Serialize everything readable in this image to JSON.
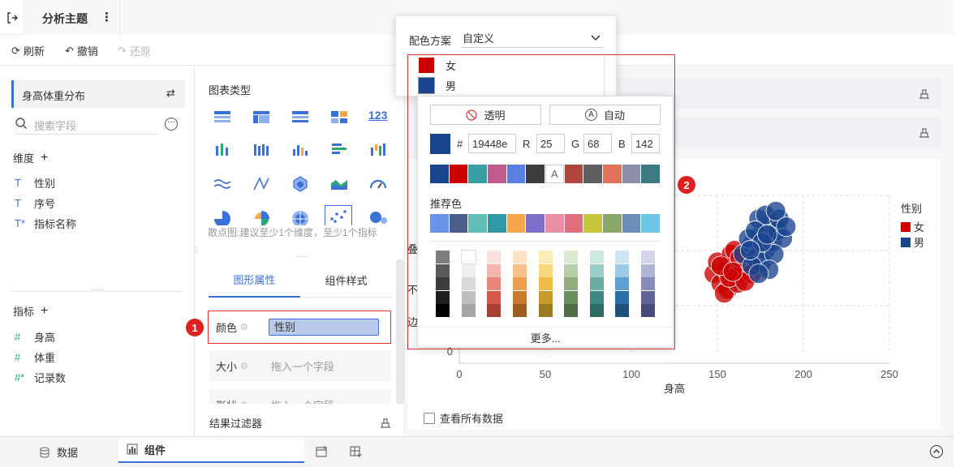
{
  "header": {
    "title": "分析主题",
    "more_icon": "more-vertical-icon"
  },
  "toolbar": {
    "refresh": "刷新",
    "undo": "撤销",
    "redo": "还原"
  },
  "left": {
    "table_name": "身高体重分布",
    "search_placeholder": "搜索字段",
    "dimensions_label": "维度",
    "dimensions": [
      {
        "icon": "T",
        "label": "性别"
      },
      {
        "icon": "T",
        "label": "序号"
      },
      {
        "icon": "T*",
        "label": "指标名称"
      }
    ],
    "measures_label": "指标",
    "measures": [
      {
        "icon": "#",
        "label": "身高"
      },
      {
        "icon": "#",
        "label": "体重"
      },
      {
        "icon": "#*",
        "label": "记录数"
      }
    ]
  },
  "chart_types": {
    "title": "图表类型",
    "hint": "散点图:建议至少1个维度，至少1个指标",
    "tab_graph": "图形属性",
    "tab_component": "组件样式",
    "color_label": "颜色",
    "color_field": "性别",
    "size_label": "大小",
    "size_placeholder": "拖入一个字段",
    "shape_label": "形状",
    "shape_placeholder": "拖入一个字段",
    "filter_label": "结果过滤器"
  },
  "color_popup": {
    "scheme_label": "配色方案",
    "scheme_value": "自定义",
    "legend_items": [
      {
        "label": "女",
        "color": "#cc0000"
      },
      {
        "label": "男",
        "color": "#19448e"
      }
    ],
    "transparent": "透明",
    "auto": "自动",
    "hex_prefix": "#",
    "hex": "19448e",
    "r_label": "R",
    "r": "25",
    "g_label": "G",
    "g": "68",
    "b_label": "B",
    "b": "142",
    "current_color": "#19448e",
    "recent_colors": [
      "#19448e",
      "#cc0000",
      "#3a9ea5",
      "#c25b8e",
      "#5b7ee5",
      "#3d3d3d",
      "#ffffff",
      "#b0473f",
      "#5f5f5f",
      "#e0735a",
      "#8d8fa8",
      "#3a7a80"
    ],
    "recommended_label": "推荐色",
    "recommended_colors": [
      "#6b93e8",
      "#4b5f8a",
      "#5fbfb8",
      "#2f9aa6",
      "#f5a84a",
      "#7b6fc9",
      "#e88fa5",
      "#e0707f",
      "#c8c63a",
      "#8aa86a",
      "#6b8fb8",
      "#6ec6e6"
    ],
    "more": "更多...",
    "palette_columns": [
      [
        "#7d7d7d",
        "#5a5a5a",
        "#3c3c3c",
        "#1e1e1e",
        "#000000"
      ],
      [
        "#ffffff",
        "#efefef",
        "#d9d9d9",
        "#bfbfbf",
        "#a5a5a5"
      ],
      [
        "#fbe1de",
        "#f5b6ad",
        "#e98579",
        "#d3574b",
        "#a94035"
      ],
      [
        "#fde2c6",
        "#f8c08c",
        "#ee9c4f",
        "#c97a2c",
        "#9c5c21"
      ],
      [
        "#fdeeb8",
        "#f8d77e",
        "#efbd45",
        "#c99b2b",
        "#9a7a22"
      ],
      [
        "#dbeace",
        "#b7cfa8",
        "#8fae7a",
        "#6a8e5c",
        "#4f7046"
      ],
      [
        "#cce9e0",
        "#9ccfc3",
        "#6aaea2",
        "#3f8a80",
        "#2d6b64"
      ],
      [
        "#cde6f2",
        "#9ccbe6",
        "#5fa2d1",
        "#2c6ea8",
        "#21507a"
      ],
      [
        "#d6d6eb",
        "#b3b3d6",
        "#8a8ab8",
        "#63639a",
        "#4a4a7a"
      ]
    ]
  },
  "behind_popup": {
    "label1": "叠",
    "label2": "不",
    "label3": "边"
  },
  "chart_data": {
    "type": "scatter",
    "xlabel": "身高",
    "xlim": [
      0,
      250
    ],
    "xticks": [
      "0",
      "50",
      "100",
      "150",
      "200",
      "250"
    ],
    "yticks": [
      "0"
    ],
    "legend_title": "性别",
    "legend_position": "right",
    "series": [
      {
        "name": "女",
        "color": "#cc0000",
        "points": [
          [
            148,
            60
          ],
          [
            152,
            55
          ],
          [
            155,
            62
          ],
          [
            158,
            58
          ],
          [
            160,
            65
          ],
          [
            156,
            52
          ],
          [
            162,
            60
          ],
          [
            150,
            66
          ],
          [
            165,
            62
          ],
          [
            158,
            70
          ],
          [
            154,
            50
          ],
          [
            162,
            55
          ],
          [
            168,
            66
          ],
          [
            160,
            72
          ],
          [
            157,
            58
          ],
          [
            163,
            68
          ],
          [
            170,
            60
          ],
          [
            152,
            64
          ],
          [
            166,
            56
          ],
          [
            159,
            61
          ]
        ]
      },
      {
        "name": "男",
        "color": "#19448e",
        "points": [
          [
            165,
            70
          ],
          [
            170,
            75
          ],
          [
            172,
            68
          ],
          [
            175,
            80
          ],
          [
            178,
            72
          ],
          [
            180,
            85
          ],
          [
            168,
            78
          ],
          [
            182,
            76
          ],
          [
            176,
            66
          ],
          [
            185,
            82
          ],
          [
            174,
            88
          ],
          [
            170,
            64
          ],
          [
            188,
            78
          ],
          [
            178,
            90
          ],
          [
            183,
            70
          ],
          [
            172,
            82
          ],
          [
            180,
            62
          ],
          [
            186,
            88
          ],
          [
            176,
            76
          ],
          [
            169,
            72
          ],
          [
            184,
            92
          ],
          [
            190,
            84
          ],
          [
            174,
            60
          ],
          [
            179,
            80
          ]
        ]
      }
    ]
  },
  "canvas": {
    "show_all": "查看所有数据"
  },
  "statusbar": {
    "data": "数据",
    "component": "组件"
  },
  "annotations": {
    "badge1": "1",
    "badge2": "2"
  }
}
